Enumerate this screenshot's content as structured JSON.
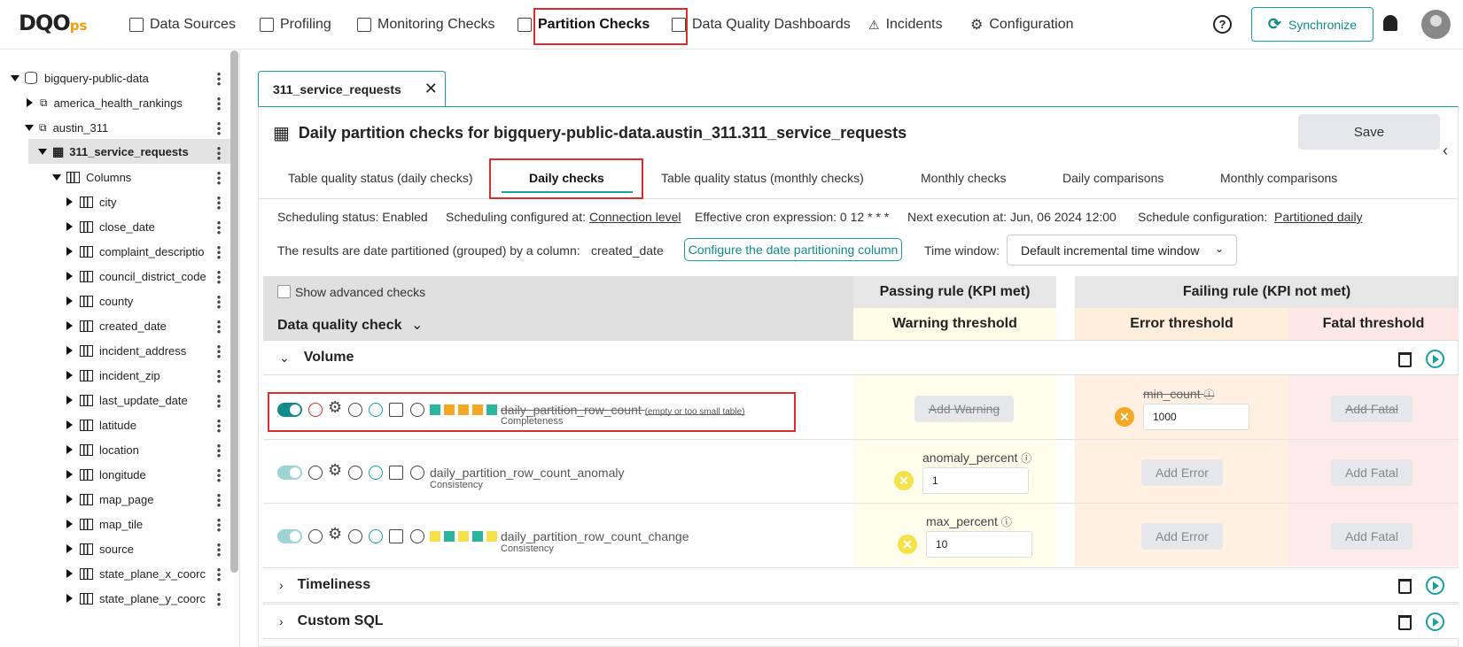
{
  "app": {
    "logo_main": "DQO",
    "logo_suffix": "ps"
  },
  "nav": [
    {
      "label": "Data Sources",
      "icon": "database-icon"
    },
    {
      "label": "Profiling",
      "icon": "profiling-icon"
    },
    {
      "label": "Monitoring Checks",
      "icon": "monitoring-icon"
    },
    {
      "label": "Partition Checks",
      "icon": "partition-icon"
    },
    {
      "label": "Data Quality Dashboards",
      "icon": "dashboard-icon"
    },
    {
      "label": "Incidents",
      "icon": "warning-icon"
    },
    {
      "label": "Configuration",
      "icon": "gear-icon"
    }
  ],
  "header": {
    "help": "?",
    "sync_label": "Synchronize"
  },
  "tree": {
    "root": "bigquery-public-data",
    "schema1": "america_health_rankings",
    "schema2": "austin_311",
    "table": "311_service_requests",
    "columns_label": "Columns",
    "columns": [
      "city",
      "close_date",
      "complaint_descriptio",
      "council_district_code",
      "county",
      "created_date",
      "incident_address",
      "incident_zip",
      "last_update_date",
      "latitude",
      "location",
      "longitude",
      "map_page",
      "map_tile",
      "source",
      "state_plane_x_coorc",
      "state_plane_y_coorc"
    ]
  },
  "tab": {
    "label": "311_service_requests",
    "close": "✕"
  },
  "page": {
    "title": "Daily partition checks for bigquery-public-data.austin_311.311_service_requests",
    "save_label": "Save"
  },
  "subtabs": [
    "Table quality status (daily checks)",
    "Daily checks",
    "Table quality status (monthly checks)",
    "Monthly checks",
    "Daily comparisons",
    "Monthly comparisons"
  ],
  "info": {
    "scheduling_status": "Scheduling status: Enabled",
    "configured_at_label": "Scheduling configured at:",
    "configured_at_value": "Connection level",
    "cron": "Effective cron expression: 0 12 * * *",
    "next_exec": "Next execution at: Jun, 06 2024 12:00",
    "schedule_label": "Schedule configuration:",
    "schedule_value": "Partitioned daily",
    "partition_label": "The results are date partitioned (grouped) by a column:",
    "partition_column": "created_date",
    "configure_btn": "Configure the date partitioning column",
    "time_window_label": "Time window:",
    "time_window_value": "Default incremental time window"
  },
  "table": {
    "show_advanced": "Show advanced checks",
    "dq_check_header": "Data quality check",
    "passing": "Passing rule (KPI met)",
    "failing": "Failing rule (KPI not met)",
    "warning": "Warning threshold",
    "error": "Error threshold",
    "fatal": "Fatal threshold"
  },
  "sections": {
    "volume": "Volume",
    "timeliness": "Timeliness",
    "custom_sql": "Custom SQL"
  },
  "checks": [
    {
      "name": "daily_partition_row_count",
      "note": "(empty or too small table)",
      "category": "Completeness",
      "warning_btn": "Add Warning",
      "error_param": "min_count",
      "error_value": "1000",
      "fatal_btn": "Add Fatal"
    },
    {
      "name": "daily_partition_row_count_anomaly",
      "category": "Consistency",
      "warning_param": "anomaly_percent",
      "warning_value": "1",
      "error_btn": "Add Error",
      "fatal_btn": "Add Fatal"
    },
    {
      "name": "daily_partition_row_count_change",
      "category": "Consistency",
      "warning_param": "max_percent",
      "warning_value": "10",
      "error_btn": "Add Error",
      "fatal_btn": "Add Fatal"
    }
  ],
  "colors": {
    "accent": "#18a0a0",
    "highlight": "#d72d2d",
    "warning": "#f5e24a",
    "error": "#f5a623"
  }
}
